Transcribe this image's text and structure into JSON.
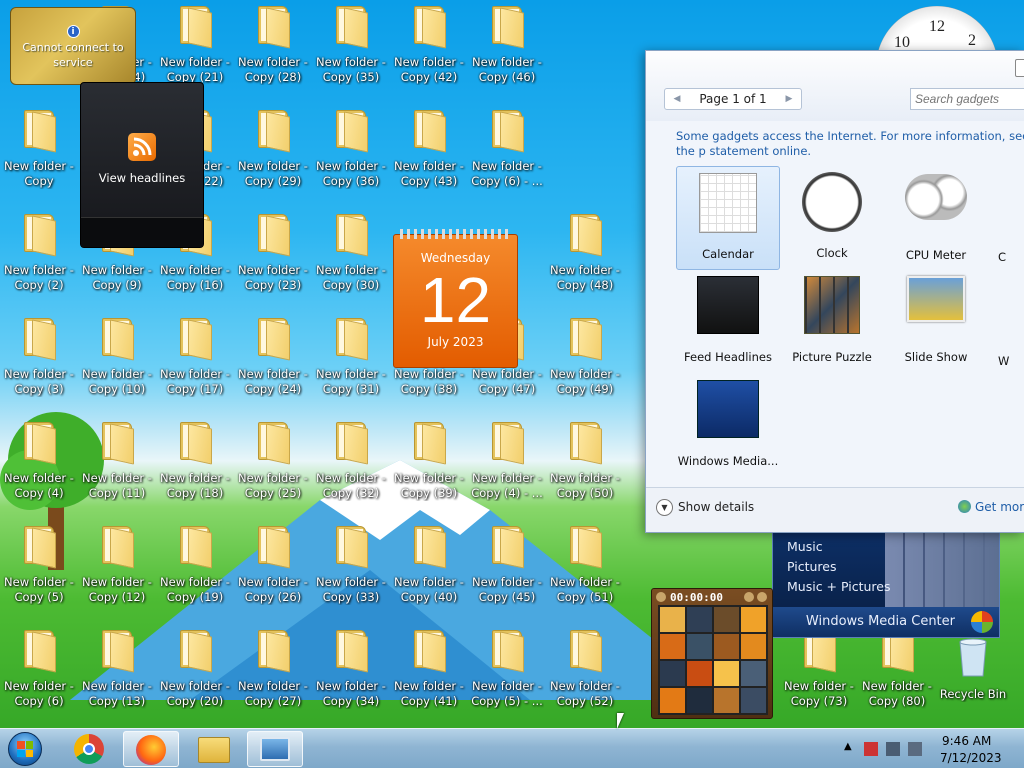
{
  "desktop": {
    "icons": [
      {
        "label1": "New folder -",
        "label2": "Copy (14)",
        "col": 1,
        "row": 0
      },
      {
        "label1": "New folder -",
        "label2": "Copy (21)",
        "col": 2,
        "row": 0
      },
      {
        "label1": "New folder -",
        "label2": "Copy (28)",
        "col": 3,
        "row": 0
      },
      {
        "label1": "New folder -",
        "label2": "Copy (35)",
        "col": 4,
        "row": 0
      },
      {
        "label1": "New folder -",
        "label2": "Copy (42)",
        "col": 5,
        "row": 0
      },
      {
        "label1": "New folder -",
        "label2": "Copy (46)",
        "col": 6,
        "row": 0
      },
      {
        "label1": "New folder -",
        "label2": "Copy",
        "col": 0,
        "row": 1
      },
      {
        "label1": "New folder -",
        "label2": "Copy (22)",
        "col": 2,
        "row": 1
      },
      {
        "label1": "New folder -",
        "label2": "Copy (29)",
        "col": 3,
        "row": 1
      },
      {
        "label1": "New folder -",
        "label2": "Copy (36)",
        "col": 4,
        "row": 1
      },
      {
        "label1": "New folder -",
        "label2": "Copy (43)",
        "col": 5,
        "row": 1
      },
      {
        "label1": "New folder -",
        "label2": "Copy (6) - ...",
        "col": 6,
        "row": 1
      },
      {
        "label1": "New folder -",
        "label2": "Copy (2)",
        "col": 0,
        "row": 2
      },
      {
        "label1": "New folder -",
        "label2": "Copy (9)",
        "col": 1,
        "row": 2
      },
      {
        "label1": "New folder -",
        "label2": "Copy (16)",
        "col": 2,
        "row": 2
      },
      {
        "label1": "New folder -",
        "label2": "Copy (23)",
        "col": 3,
        "row": 2
      },
      {
        "label1": "New folder -",
        "label2": "Copy (30)",
        "col": 4,
        "row": 2
      },
      {
        "label1": "New folder -",
        "label2": "Copy (48)",
        "col": 7,
        "row": 2
      },
      {
        "label1": "New folder -",
        "label2": "Copy (3)",
        "col": 0,
        "row": 3
      },
      {
        "label1": "New folder -",
        "label2": "Copy (10)",
        "col": 1,
        "row": 3
      },
      {
        "label1": "New folder -",
        "label2": "Copy (17)",
        "col": 2,
        "row": 3
      },
      {
        "label1": "New folder -",
        "label2": "Copy (24)",
        "col": 3,
        "row": 3
      },
      {
        "label1": "New folder -",
        "label2": "Copy (31)",
        "col": 4,
        "row": 3
      },
      {
        "label1": "New folder -",
        "label2": "Copy (38)",
        "col": 5,
        "row": 3
      },
      {
        "label1": "New folder -",
        "label2": "Copy (47)",
        "col": 6,
        "row": 3
      },
      {
        "label1": "New folder -",
        "label2": "Copy (49)",
        "col": 7,
        "row": 3
      },
      {
        "label1": "New folder -",
        "label2": "Copy (4)",
        "col": 0,
        "row": 4
      },
      {
        "label1": "New folder -",
        "label2": "Copy (11)",
        "col": 1,
        "row": 4
      },
      {
        "label1": "New folder -",
        "label2": "Copy (18)",
        "col": 2,
        "row": 4
      },
      {
        "label1": "New folder -",
        "label2": "Copy (25)",
        "col": 3,
        "row": 4
      },
      {
        "label1": "New folder -",
        "label2": "Copy (32)",
        "col": 4,
        "row": 4
      },
      {
        "label1": "New folder -",
        "label2": "Copy (39)",
        "col": 5,
        "row": 4
      },
      {
        "label1": "New folder -",
        "label2": "Copy (4) - ...",
        "col": 6,
        "row": 4
      },
      {
        "label1": "New folder -",
        "label2": "Copy (50)",
        "col": 7,
        "row": 4
      },
      {
        "label1": "New folder -",
        "label2": "Copy (5)",
        "col": 0,
        "row": 5
      },
      {
        "label1": "New folder -",
        "label2": "Copy (12)",
        "col": 1,
        "row": 5
      },
      {
        "label1": "New folder -",
        "label2": "Copy (19)",
        "col": 2,
        "row": 5
      },
      {
        "label1": "New folder -",
        "label2": "Copy (26)",
        "col": 3,
        "row": 5
      },
      {
        "label1": "New folder -",
        "label2": "Copy (33)",
        "col": 4,
        "row": 5
      },
      {
        "label1": "New folder -",
        "label2": "Copy (40)",
        "col": 5,
        "row": 5
      },
      {
        "label1": "New folder -",
        "label2": "Copy (45)",
        "col": 6,
        "row": 5
      },
      {
        "label1": "New folder -",
        "label2": "Copy (51)",
        "col": 7,
        "row": 5
      },
      {
        "label1": "New folder -",
        "label2": "Copy (6)",
        "col": 0,
        "row": 6
      },
      {
        "label1": "New folder -",
        "label2": "Copy (13)",
        "col": 1,
        "row": 6
      },
      {
        "label1": "New folder -",
        "label2": "Copy (20)",
        "col": 2,
        "row": 6
      },
      {
        "label1": "New folder -",
        "label2": "Copy (27)",
        "col": 3,
        "row": 6
      },
      {
        "label1": "New folder -",
        "label2": "Copy (34)",
        "col": 4,
        "row": 6
      },
      {
        "label1": "New folder -",
        "label2": "Copy (41)",
        "col": 5,
        "row": 6
      },
      {
        "label1": "New folder -",
        "label2": "Copy (5) - ...",
        "col": 6,
        "row": 6
      },
      {
        "label1": "New folder -",
        "label2": "Copy (52)",
        "col": 7,
        "row": 6
      },
      {
        "label1": "New folder -",
        "label2": "Copy (73)",
        "col": 10,
        "row": 6
      },
      {
        "label1": "New folder -",
        "label2": "Copy (80)",
        "col": 11,
        "row": 6
      }
    ],
    "recycle_bin": "Recycle Bin"
  },
  "gadgets": {
    "weather": {
      "message": "Cannot connect to service",
      "icon": "info-icon"
    },
    "feed": {
      "label": "View headlines",
      "icon": "rss-icon"
    },
    "calendar": {
      "weekday": "Wednesday",
      "day": "12",
      "month_year": "July 2023"
    },
    "clock": {
      "numeral_top": "12",
      "numeral_left": "10",
      "numeral_right": "2"
    },
    "media_center": {
      "items": [
        "Music",
        "Pictures",
        "Music + Pictures"
      ],
      "title": "Windows Media Center"
    },
    "puzzle": {
      "timer": "00:00:00"
    }
  },
  "gallery": {
    "pager": "Page 1 of 1",
    "search_placeholder": "Search gadgets",
    "note": "Some gadgets access the Internet.  For more information, see the p statement online.",
    "items": [
      {
        "label": "Calendar",
        "selected": true
      },
      {
        "label": "Clock",
        "selected": false
      },
      {
        "label": "CPU Meter",
        "selected": false
      },
      {
        "label": "C",
        "selected": false
      },
      {
        "label": "Feed Headlines",
        "selected": false
      },
      {
        "label": "Picture Puzzle",
        "selected": false
      },
      {
        "label": "Slide Show",
        "selected": false
      },
      {
        "label": "W",
        "selected": false
      },
      {
        "label": "Windows Media...",
        "selected": false
      }
    ],
    "show_details": "Show details",
    "get_more": "Get more gadg"
  },
  "taskbar": {
    "apps": [
      "start-button",
      "chrome",
      "firefox",
      "file-explorer",
      "gadgets"
    ],
    "time": "9:46 AM",
    "date": "7/12/2023"
  }
}
